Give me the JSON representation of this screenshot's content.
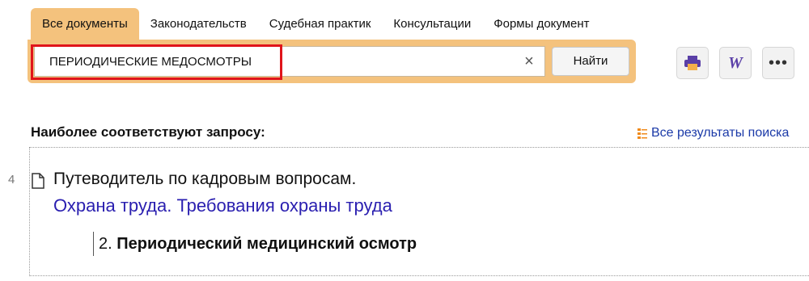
{
  "tabs": [
    {
      "label": "Все документы",
      "active": true
    },
    {
      "label": "Законодательств",
      "active": false
    },
    {
      "label": "Судебная практик",
      "active": false
    },
    {
      "label": "Консультации",
      "active": false
    },
    {
      "label": "Формы документ",
      "active": false
    }
  ],
  "search": {
    "value": "ПЕРИОДИЧЕСКИЕ МЕДОСМОТРЫ",
    "clear_symbol": "×",
    "find_label": "Найти"
  },
  "toolbar": {
    "print_icon": "printer-icon",
    "word_glyph": "W",
    "more_glyph": "•••"
  },
  "results": {
    "heading": "Наиболее соответствуют запросу:",
    "all_results_label": "Все результаты поиска",
    "items": [
      {
        "number": "4",
        "title": "Путеводитель по кадровым вопросам.",
        "link": "Охрана труда. Требования охраны труда",
        "fragment_number": "2.",
        "fragment_text": "Периодический медицинский осмотр"
      }
    ]
  },
  "colors": {
    "accent": "#f4c27d",
    "link": "#2a1fb0",
    "highlight": "#e0151b"
  }
}
